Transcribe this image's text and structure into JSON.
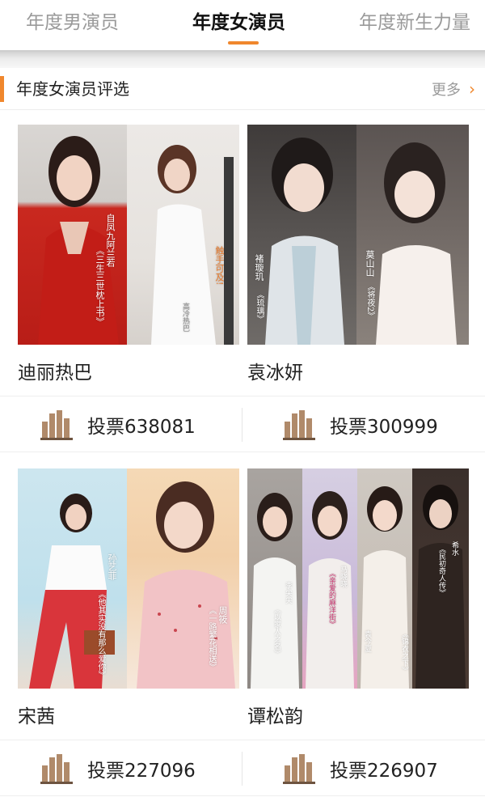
{
  "tabs": [
    {
      "label": "年度男演员"
    },
    {
      "label": "年度女演员"
    },
    {
      "label": "年度新生力量"
    }
  ],
  "active_tab": "年度女演员",
  "section": {
    "title": "年度女演员评选",
    "more_label": "更多"
  },
  "accent_color": "#f0872d",
  "cards": [
    {
      "name": "迪丽热巴",
      "votes": "投票638081",
      "captions": [
        "自凤九阿兰若",
        "《三生三世枕上书》",
        "高冷热巴",
        "触手可及!"
      ]
    },
    {
      "name": "袁冰妍",
      "votes": "投票300999",
      "captions": [
        "褚璇玑",
        "《琉璃》",
        "莫山山",
        "《将夜2》"
      ]
    },
    {
      "name": "宋茜",
      "votes": "投票227096",
      "captions": [
        "孙艺菲",
        "《他其实没有那么爱你》",
        "周筱",
        "《一路繁花相送》"
      ]
    },
    {
      "name": "谭松韵",
      "votes": "投票226907",
      "captions": [
        "李尖尖",
        "《以家人之名》",
        "马晓晓",
        "《亲爱的麻洋街》",
        "希水",
        "《民初奇人传》",
        "袁今夏",
        "《锦衣之下》"
      ]
    }
  ]
}
